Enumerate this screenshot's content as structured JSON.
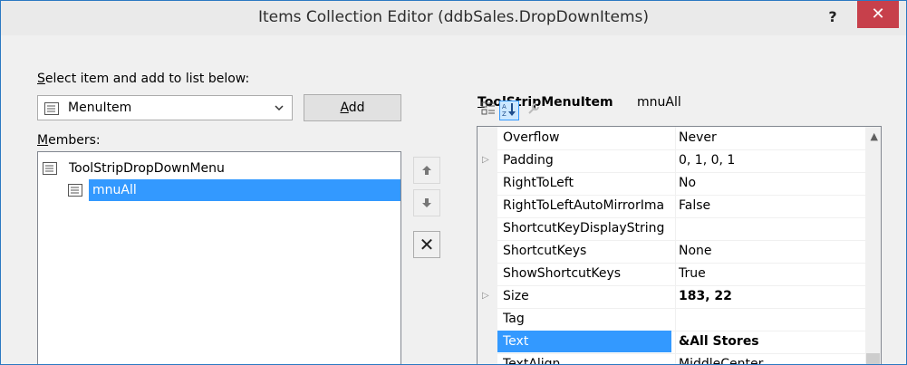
{
  "window": {
    "title": "Items Collection Editor (ddbSales.DropDownItems)",
    "help_label": "?",
    "close_label": "✕"
  },
  "left": {
    "select_label_first": "S",
    "select_label_rest": "elect item and add to list below:",
    "combo_value": "MenuItem",
    "add_button_first": "A",
    "add_button_rest": "dd",
    "members_label_first": "M",
    "members_label_rest": "embers:",
    "members": [
      {
        "label": "ToolStripDropDownMenu"
      },
      {
        "label": "mnuAll",
        "selected": true
      }
    ]
  },
  "side_buttons": {
    "up_icon": "arrow-up-icon",
    "down_icon": "arrow-down-icon",
    "delete_label": "✕"
  },
  "properties": {
    "type_label_first": "T",
    "type_label_rest": "oolStripMenuItem",
    "object_name": "mnuAll",
    "rows": [
      {
        "name": "Overflow",
        "value": "Never"
      },
      {
        "name": "Padding",
        "value": "0, 1, 0, 1",
        "expandable": true
      },
      {
        "name": "RightToLeft",
        "value": "No"
      },
      {
        "name": "RightToLeftAutoMirrorIma",
        "value": "False"
      },
      {
        "name": "ShortcutKeyDisplayString",
        "value": ""
      },
      {
        "name": "ShortcutKeys",
        "value": "None"
      },
      {
        "name": "ShowShortcutKeys",
        "value": "True"
      },
      {
        "name": "Size",
        "value": "183, 22",
        "expandable": true,
        "bold": true
      },
      {
        "name": "Tag",
        "value": ""
      },
      {
        "name": "Text",
        "value": "&All Stores",
        "selected": true,
        "bold": true
      },
      {
        "name": "TextAlign",
        "value": "MiddleCenter"
      }
    ]
  }
}
